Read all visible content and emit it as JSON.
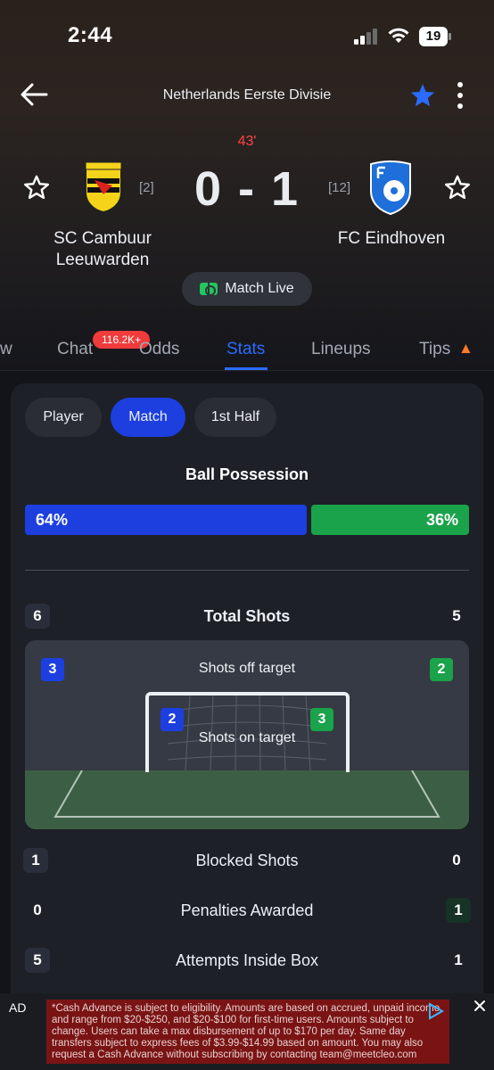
{
  "status_bar": {
    "time": "2:44",
    "battery": "19"
  },
  "header": {
    "league": "Netherlands Eerste Divisie"
  },
  "match": {
    "minute": "43'",
    "score": "0 - 1",
    "home": {
      "name_line1": "SC Cambuur",
      "name_line2": "Leeuwarden",
      "rank": "[2]"
    },
    "away": {
      "name_line1": "FC Eindhoven",
      "rank": "[12]"
    },
    "live_label": "Match Live"
  },
  "tabs": {
    "overview_partial": "w",
    "chat": "Chat",
    "chat_badge": "116.2K+",
    "odds": "Odds",
    "stats": "Stats",
    "lineups": "Lineups",
    "tips": "Tips"
  },
  "filters": {
    "player": "Player",
    "match": "Match",
    "first_half": "1st Half"
  },
  "possession": {
    "title": "Ball Possession",
    "home": "64%",
    "away": "36%",
    "home_value": 64,
    "away_value": 36
  },
  "stats": {
    "total_shots": {
      "label": "Total Shots",
      "home": "6",
      "away": "5"
    },
    "shots_off_target": {
      "label": "Shots off target",
      "home": "3",
      "away": "2"
    },
    "shots_on_target": {
      "label": "Shots on target",
      "home": "2",
      "away": "3"
    },
    "blocked_shots": {
      "label": "Blocked Shots",
      "home": "1",
      "away": "0"
    },
    "penalties_awarded": {
      "label": "Penalties Awarded",
      "home": "0",
      "away": "1"
    },
    "attempts_inside_box": {
      "label": "Attempts Inside Box",
      "home": "5",
      "away": "1"
    }
  },
  "ad": {
    "label": "AD",
    "text": "*Cash Advance is subject to eligibility. Amounts are based on accrued, unpaid income and range from $20-$250, and $20-$100 for first-time users. Amounts subject to change. Users can take a max disbursement of up to $170 per day. Same day transfers subject to express fees of $3.99-$14.99 based on amount. You may also request a Cash Advance without subscribing by contacting team@meetcleo.com"
  },
  "colors": {
    "home": "#1d3fe0",
    "away": "#1aa34a",
    "accent": "#2b6cff",
    "live_minute": "#ff4444"
  }
}
